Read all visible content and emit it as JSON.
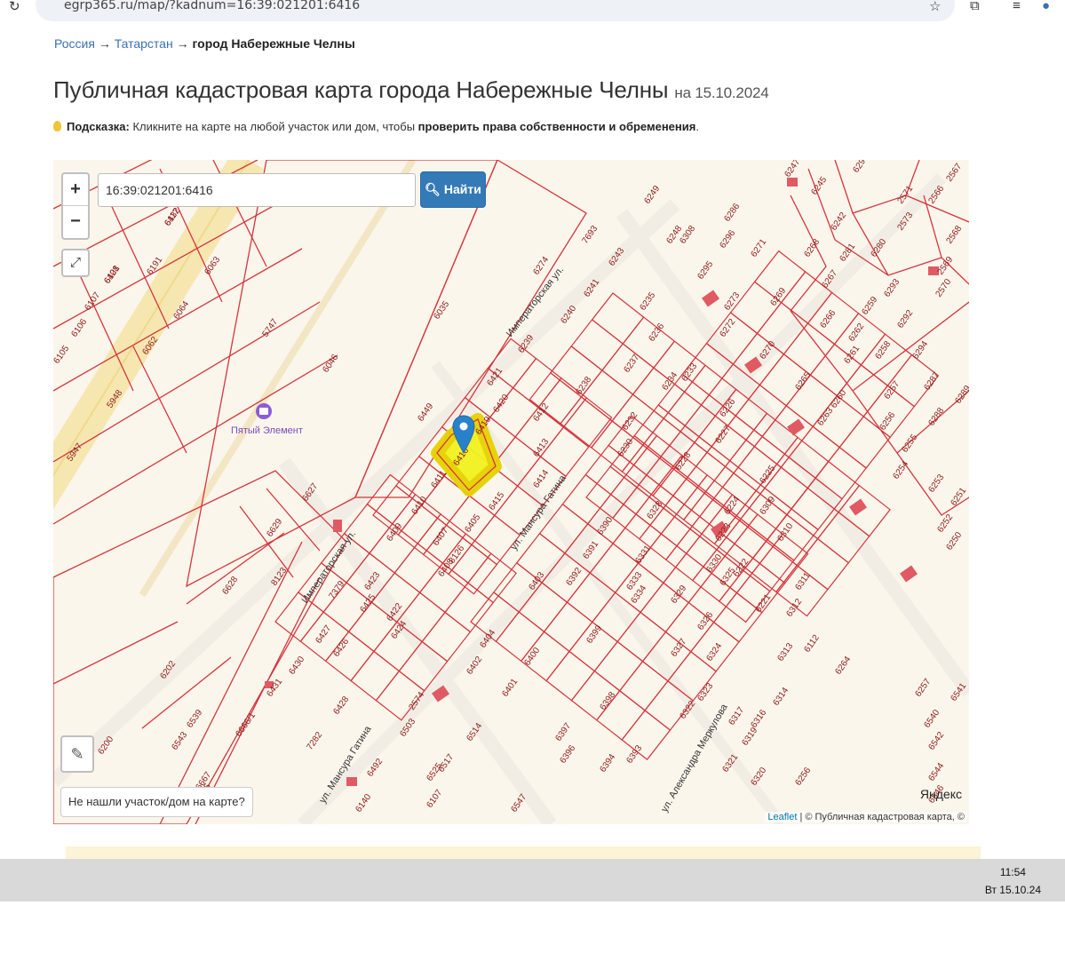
{
  "browser": {
    "url": "egrp365.ru/map/?kadnum=16:39:021201:6416"
  },
  "breadcrumb": {
    "items": [
      "Россия",
      "Татарстан"
    ],
    "separator": "→",
    "current": "город Набережные Челны"
  },
  "page": {
    "title": "Публичная кадастровая карта города Набережные Челны",
    "date": "на 15.10.2024"
  },
  "hint": {
    "label": "Подсказка:",
    "text": "Кликните на карте на любой участок или дом, чтобы",
    "bold_text": "проверить права собственности и обременения",
    "end": "."
  },
  "map": {
    "search_value": "16:39:021201:6416",
    "find_button": "Найти",
    "zoom_in": "+",
    "zoom_out": "−",
    "not_found": "Не нашли участок/дом на карте?",
    "attribution_link": "Leaflet",
    "attribution_text": "| © Публичная кадастровая карта, ©",
    "provider": "Яндекс",
    "poi": "Пятый Элемент",
    "streets": [
      "Императорская ул.",
      "ул. Мансура Гатина",
      "Императорская ул.",
      "ул. Мансура Гатина",
      "ул. Александра Меркулова"
    ],
    "colors": {
      "parcel": "#d4353d",
      "road": "#f6e7b0",
      "highlight": "#f2f21e",
      "building": "#e05a63",
      "background": "#fbf6ec"
    },
    "parcels": [
      "6117",
      "6108",
      "6107",
      "6106",
      "6105",
      "6191",
      "6063",
      "6064",
      "6062",
      "5948",
      "5947",
      "5747",
      "6046",
      "6035",
      "6274",
      "7693",
      "6449",
      "6421",
      "6420",
      "6419",
      "6416",
      "6411",
      "6410",
      "6409",
      "6407",
      "6408",
      "6415",
      "6405",
      "6414",
      "6413",
      "6412",
      "6239",
      "6240",
      "6241",
      "6243",
      "6238",
      "6237",
      "6236",
      "6235",
      "6234",
      "6233",
      "6232",
      "6230",
      "6228",
      "6227",
      "6226",
      "6225",
      "6224",
      "6223",
      "6222",
      "6221",
      "6629",
      "6628",
      "6627",
      "6202",
      "6200",
      "6431",
      "6430",
      "6427",
      "6428",
      "6426",
      "6425",
      "6423",
      "6424",
      "6422",
      "6403",
      "6404",
      "6402",
      "6401",
      "6400",
      "6399",
      "6398",
      "6397",
      "6396",
      "6394",
      "6393",
      "6392",
      "6391",
      "6390",
      "6331",
      "6333",
      "6334",
      "6328",
      "6327",
      "6326",
      "6329",
      "6330",
      "6325",
      "6324",
      "6323",
      "6322",
      "6321",
      "6320",
      "6319",
      "6317",
      "6316",
      "6314",
      "6313",
      "6312",
      "6311",
      "6310",
      "6309",
      "6308",
      "6296",
      "6295",
      "6286",
      "6273",
      "6272",
      "6271",
      "6270",
      "6269",
      "6268",
      "6267",
      "6266",
      "6265",
      "6263",
      "6262",
      "6261",
      "6260",
      "6259",
      "6258",
      "6257",
      "6256",
      "6255",
      "6254",
      "6253",
      "6252",
      "6251",
      "6250",
      "6249",
      "6248",
      "6247",
      "6245",
      "6242",
      "6281",
      "6280",
      "6293",
      "6292",
      "6294",
      "6287",
      "6288",
      "6289",
      "6290",
      "2566",
      "2567",
      "2568",
      "2569",
      "2570",
      "2571",
      "2573",
      "2574",
      "6503",
      "6525",
      "6514",
      "6517",
      "6492",
      "6547",
      "6140",
      "6107",
      "6112",
      "6264",
      "6256",
      "6257",
      "6540",
      "6542",
      "6544",
      "6546",
      "6541",
      "6543",
      "6539",
      "6666/1",
      "6667",
      "6666/5",
      "8123",
      "8126",
      "7282",
      "7379",
      "6432",
      "6421"
    ]
  }
}
